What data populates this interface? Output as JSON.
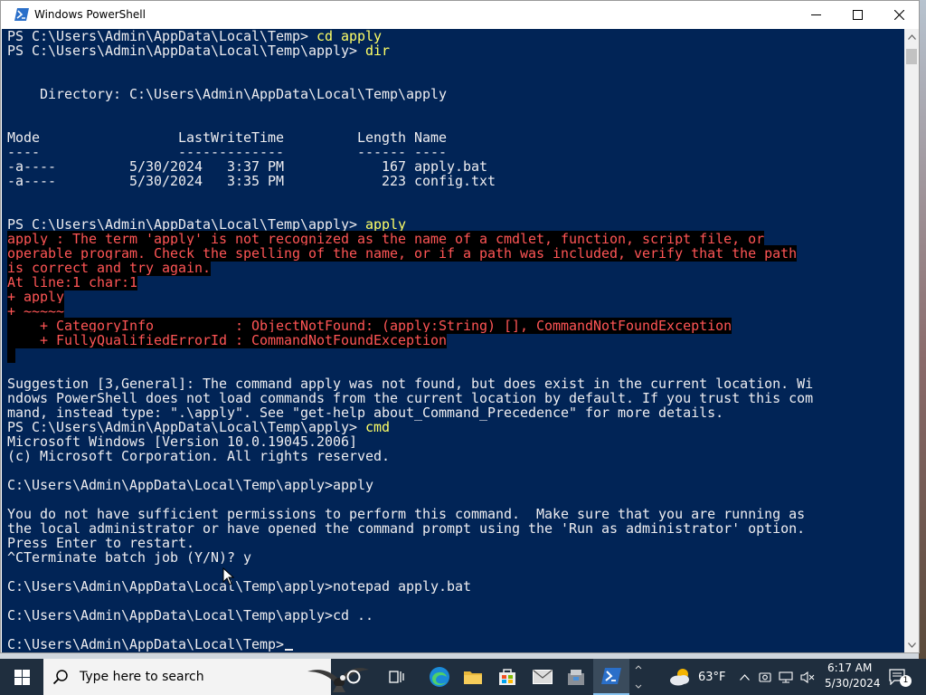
{
  "window": {
    "title": "Windows PowerShell"
  },
  "console": {
    "lines": [
      {
        "t": "PS C:\\Users\\Admin\\AppData\\Local\\Temp> ",
        "c": "cd apply"
      },
      {
        "t": "PS C:\\Users\\Admin\\AppData\\Local\\Temp\\apply> ",
        "c": "dir"
      },
      {
        "t": ""
      },
      {
        "t": ""
      },
      {
        "t": "    Directory: C:\\Users\\Admin\\AppData\\Local\\Temp\\apply"
      },
      {
        "t": ""
      },
      {
        "t": ""
      },
      {
        "t": "Mode                 LastWriteTime         Length Name"
      },
      {
        "t": "----                 -------------         ------ ----"
      },
      {
        "t": "-a----         5/30/2024   3:37 PM            167 apply.bat"
      },
      {
        "t": "-a----         5/30/2024   3:35 PM            223 config.txt"
      },
      {
        "t": ""
      },
      {
        "t": ""
      },
      {
        "t": "PS C:\\Users\\Admin\\AppData\\Local\\Temp\\apply> ",
        "c": "apply"
      },
      {
        "e": "apply : The term 'apply' is not recognized as the name of a cmdlet, function, script file, or"
      },
      {
        "e": "operable program. Check the spelling of the name, or if a path was included, verify that the path"
      },
      {
        "e": "is correct and try again."
      },
      {
        "e": "At line:1 char:1"
      },
      {
        "e": "+ apply"
      },
      {
        "e": "+ ~~~~~"
      },
      {
        "e": "    + CategoryInfo          : ObjectNotFound: (apply:String) [], CommandNotFoundException"
      },
      {
        "e": "    + FullyQualifiedErrorId : CommandNotFoundException"
      },
      {
        "e": " "
      },
      {
        "t": ""
      },
      {
        "t": "Suggestion [3,General]: The command apply was not found, but does exist in the current location. Wi"
      },
      {
        "t": "ndows PowerShell does not load commands from the current location by default. If you trust this com"
      },
      {
        "t": "mand, instead type: \".\\apply\". See \"get-help about_Command_Precedence\" for more details."
      },
      {
        "t": "PS C:\\Users\\Admin\\AppData\\Local\\Temp\\apply> ",
        "c": "cmd"
      },
      {
        "t": "Microsoft Windows [Version 10.0.19045.2006]"
      },
      {
        "t": "(c) Microsoft Corporation. All rights reserved."
      },
      {
        "t": ""
      },
      {
        "t": "C:\\Users\\Admin\\AppData\\Local\\Temp\\apply>apply"
      },
      {
        "t": ""
      },
      {
        "t": "You do not have sufficient permissions to perform this command.  Make sure that you are running as"
      },
      {
        "t": "the local administrator or have opened the command prompt using the 'Run as administrator' option."
      },
      {
        "t": "Press Enter to restart."
      },
      {
        "t": "^CTerminate batch job (Y/N)? y"
      },
      {
        "t": ""
      },
      {
        "t": "C:\\Users\\Admin\\AppData\\Local\\Temp\\apply>notepad apply.bat"
      },
      {
        "t": ""
      },
      {
        "t": "C:\\Users\\Admin\\AppData\\Local\\Temp\\apply>cd .."
      },
      {
        "t": ""
      },
      {
        "t": "C:\\Users\\Admin\\AppData\\Local\\Temp>",
        "cursor": true
      }
    ]
  },
  "taskbar": {
    "search_placeholder": "Type here to search",
    "weather_temp": "63°F",
    "time": "6:17 AM",
    "date": "5/30/2024",
    "notification_count": "1"
  },
  "colors": {
    "console_bg": "#012456",
    "console_fg": "#eeedf0",
    "error_fg": "#ff5555",
    "command_fg": "#ffff66",
    "taskbar_bg": "#1f2e3e"
  }
}
